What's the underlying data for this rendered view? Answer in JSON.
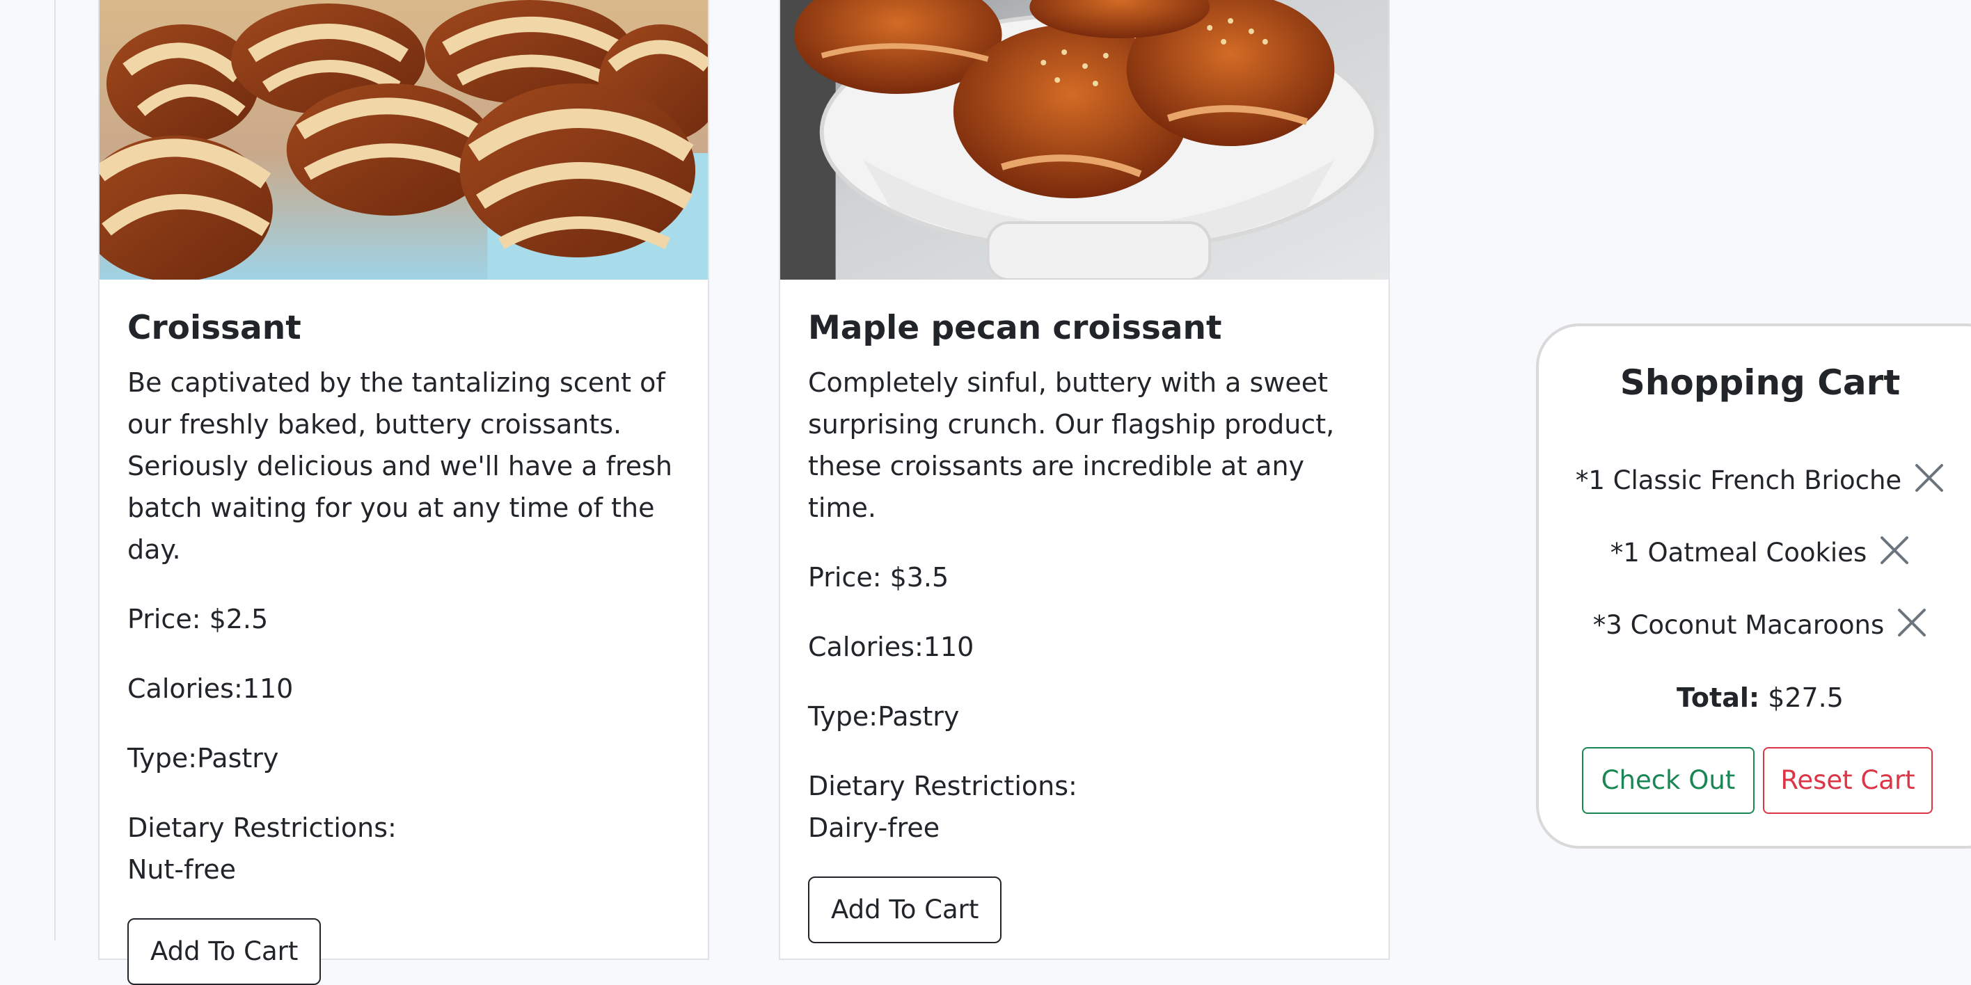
{
  "products": [
    {
      "title": "Croissant",
      "description": "Be captivated by the tantalizing scent of our freshly baked, buttery croissants. Seriously delicious and we'll have a fresh batch waiting for you at any time of the day.",
      "price": "Price: $2.5",
      "calories": "Calories:110",
      "type": "Type:Pastry",
      "dietary_label": "Dietary Restrictions:",
      "dietary_value": "Nut-free",
      "button": "Add To Cart"
    },
    {
      "title": "Maple pecan croissant",
      "description": "Completely sinful, buttery with a sweet surprising crunch. Our flagship product, these croissants are incredible at any time.",
      "price": "Price: $3.5",
      "calories": "Calories:110",
      "type": "Type:Pastry",
      "dietary_label": "Dietary Restrictions:",
      "dietary_value": "Dairy-free",
      "button": "Add To Cart"
    }
  ],
  "cart": {
    "title": "Shopping Cart",
    "items": [
      "*1 Classic French Brioche",
      "*1 Oatmeal Cookies",
      "*3 Coconut Macaroons"
    ],
    "total_label": "Total:",
    "total_value": "$27.5",
    "checkout_label": "Check Out",
    "reset_label": "Reset Cart",
    "remove_icon": "close-icon"
  },
  "colors": {
    "success": "#198754",
    "danger": "#dc3545",
    "page_bg": "#f8f9fd"
  }
}
